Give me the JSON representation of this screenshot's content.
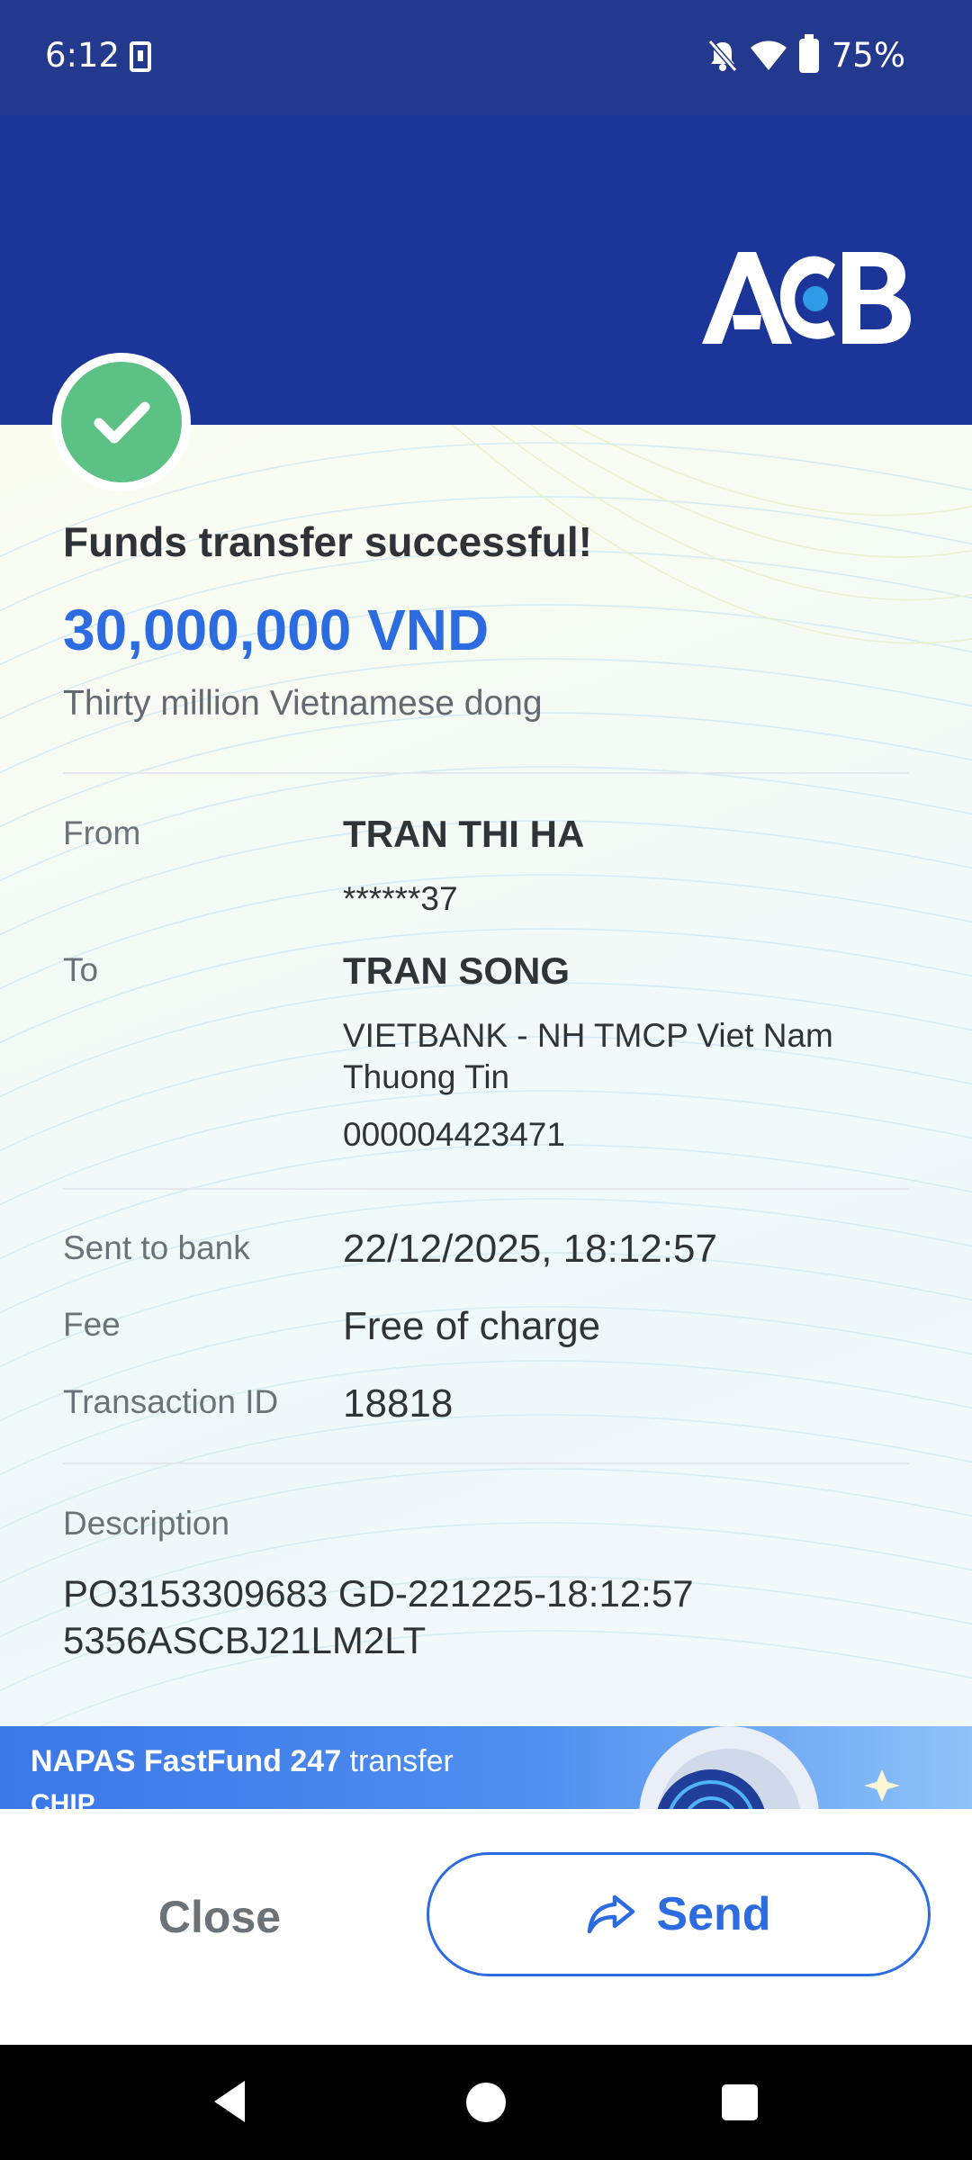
{
  "status_bar": {
    "time": "6:12",
    "battery": "75%",
    "icons": [
      "download-icon",
      "bell-off-icon",
      "wifi-icon",
      "battery-icon"
    ]
  },
  "header": {
    "brand_logo_text": "ACB",
    "background_color": "#1b3598"
  },
  "receipt": {
    "title": "Funds transfer successful!",
    "amount": "30,000,000 VND",
    "amount_words": "Thirty million Vietnamese dong",
    "from": {
      "label": "From",
      "name": "TRAN THI HA",
      "account": "******37"
    },
    "to": {
      "label": "To",
      "name": "TRAN SONG",
      "bank": "VIETBANK - NH TMCP Viet Nam Thuong Tin",
      "account": "000004423471"
    },
    "details": [
      {
        "label": "Sent to bank",
        "value": "22/12/2025, 18:12:57"
      },
      {
        "label": "Fee",
        "value": "Free of charge"
      },
      {
        "label": "Transaction ID",
        "value": "18818"
      }
    ],
    "description": {
      "label": "Description",
      "value": "PO3153309683 GD-221225-18:12:57 5356ASCBJ21LM2LT"
    },
    "colors": {
      "amount": "#2d6be0",
      "success": "#5cc185"
    }
  },
  "banner": {
    "bold_text": "NAPAS FastFund 247",
    "text": " transfer",
    "sub_text": "CHIP"
  },
  "actions": {
    "close_label": "Close",
    "send_label": "Send"
  },
  "nav": {
    "icons": [
      "back-icon",
      "home-icon",
      "recents-icon"
    ]
  }
}
